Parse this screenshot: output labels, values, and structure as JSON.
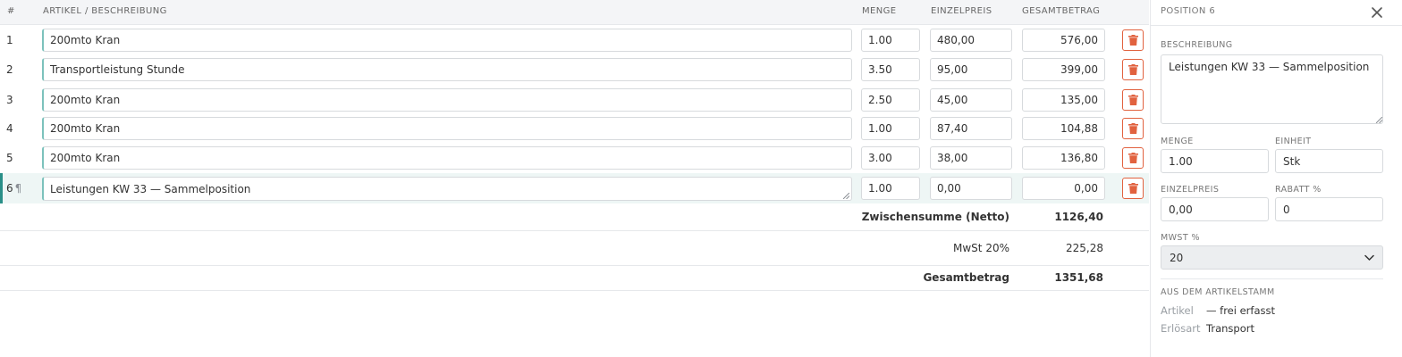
{
  "table": {
    "headers": {
      "num": "#",
      "description": "ARTIKEL / BESCHREIBUNG",
      "quantity": "MENGE",
      "unit_price": "EINZELPREIS",
      "total": "GESAMTBETRAG"
    },
    "rows": [
      {
        "num": "1",
        "description": "200mto Kran",
        "quantity": "1.00",
        "unit_price": "480,00",
        "total": "576,00"
      },
      {
        "num": "2",
        "description": "Transportleistung Stunde",
        "quantity": "3.50",
        "unit_price": "95,00",
        "total": "399,00"
      },
      {
        "num": "3",
        "description": "200mto Kran",
        "quantity": "2.50",
        "unit_price": "45,00",
        "total": "135,00"
      },
      {
        "num": "4",
        "description": "200mto Kran",
        "quantity": "1.00",
        "unit_price": "87,40",
        "total": "104,88"
      },
      {
        "num": "5",
        "description": "200mto Kran",
        "quantity": "3.00",
        "unit_price": "38,00",
        "total": "136,80"
      },
      {
        "num": "6",
        "marker": "¶",
        "description": "Leistungen KW 33 — Sammelposition",
        "quantity": "1.00",
        "unit_price": "0,00",
        "total": "0,00"
      }
    ],
    "summary": {
      "subtotal_label": "Zwischensumme (Netto)",
      "subtotal_value": "1126,40",
      "vat_label": "MwSt 20%",
      "vat_value": "225,28",
      "grand_label": "Gesamtbetrag",
      "grand_value": "1351,68"
    }
  },
  "panel": {
    "title": "POSITION 6",
    "description_label": "BESCHREIBUNG",
    "description_value": "Leistungen KW 33 — Sammelposition",
    "quantity_label": "MENGE",
    "quantity_value": "1.00",
    "unit_label": "EINHEIT",
    "unit_value": "Stk",
    "unit_price_label": "EINZELPREIS",
    "unit_price_value": "0,00",
    "discount_label": "RABATT %",
    "discount_value": "0",
    "vat_label": "MWST %",
    "vat_value": "20",
    "master_title": "AUS DEM ARTIKELSTAMM",
    "article_key": "Artikel",
    "article_value": "— frei erfasst",
    "revenue_key": "Erlösart",
    "revenue_value": "Transport"
  },
  "colors": {
    "accent": "#2a8f88",
    "delete": "#e1623f",
    "selected_row_bg": "#eef6f5"
  },
  "icons": {
    "delete": "trash-icon",
    "close": "close-icon",
    "select": "chevron-down-icon",
    "resize": "resize-grip-icon"
  }
}
